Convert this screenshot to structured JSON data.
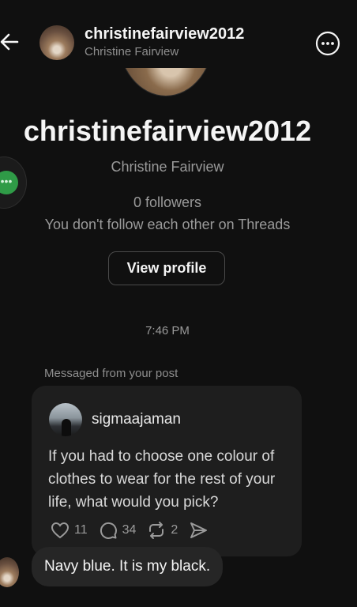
{
  "header": {
    "username": "christinefairview2012",
    "full_name": "Christine Fairview"
  },
  "profile": {
    "username": "christinefairview2012",
    "full_name": "Christine Fairview",
    "followers": "0 followers",
    "follow_note": "You don't follow each other on Threads",
    "view_profile_label": "View profile"
  },
  "thread": {
    "timestamp": "7:46 PM",
    "context_label": "Messaged from your post",
    "post": {
      "author": "sigmaajaman",
      "text": "If you had to choose one colour of clothes to wear for the rest of your life, what would you pick?",
      "likes": "11",
      "comments": "34",
      "reposts": "2"
    },
    "reply": "Navy blue. It is my black."
  },
  "icons": {
    "back": "arrow-left-icon",
    "more": "more-options-icon",
    "like": "heart-icon",
    "comment": "comment-icon",
    "repost": "repost-icon",
    "share": "send-icon"
  },
  "colors": {
    "background": "#101010",
    "card": "#1e1e1e",
    "bubble": "#262626",
    "muted_text": "#9a9a9a",
    "green": "#2f9b47"
  }
}
